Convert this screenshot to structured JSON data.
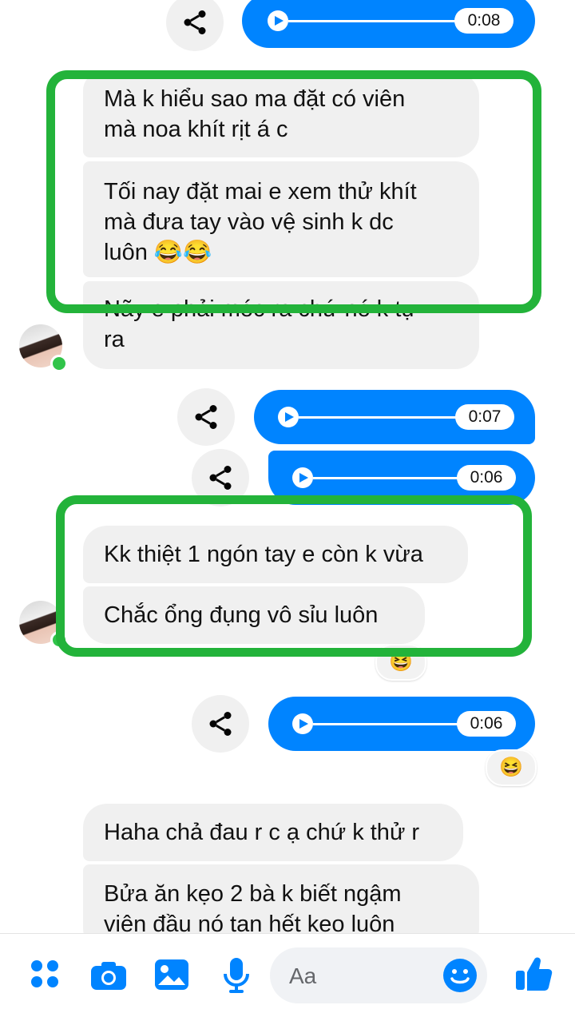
{
  "conversation": {
    "messages_top": [
      {
        "text": "Mà k hiểu sao ma đặt có viên\nmà noa khít rịt á c"
      },
      {
        "text": "Tối nay đặt mai e xem thử khít\nmà đưa tay vào vệ sinh k dc\nluôn 😂😂"
      },
      {
        "text": "Nãy e phải móc ra chứ nó k tự\nra"
      }
    ],
    "messages_mid": [
      {
        "text": "Kk thiệt 1 ngón tay e còn k vừa"
      },
      {
        "text": "Chắc ổng đụng vô sỉu luôn"
      }
    ],
    "messages_bottom": [
      {
        "text": "Haha chả đau r c ạ chứ k thử r"
      },
      {
        "text": "Bửa ăn kẹo 2 bà k biết ngậm\nviên đầu nó tan hết keo luôn"
      }
    ],
    "voice_messages": [
      {
        "duration": "0:08"
      },
      {
        "duration": "0:07"
      },
      {
        "duration": "0:06"
      },
      {
        "duration": "0:06"
      }
    ],
    "reactions": [
      "😆",
      "😆"
    ],
    "highlight_color": "#23b33a",
    "accent_color": "#0084ff"
  },
  "composer": {
    "placeholder": "Aa",
    "icons": [
      "menu-icon",
      "camera-icon",
      "image-icon",
      "microphone-icon",
      "emoji-icon",
      "like-icon"
    ]
  }
}
